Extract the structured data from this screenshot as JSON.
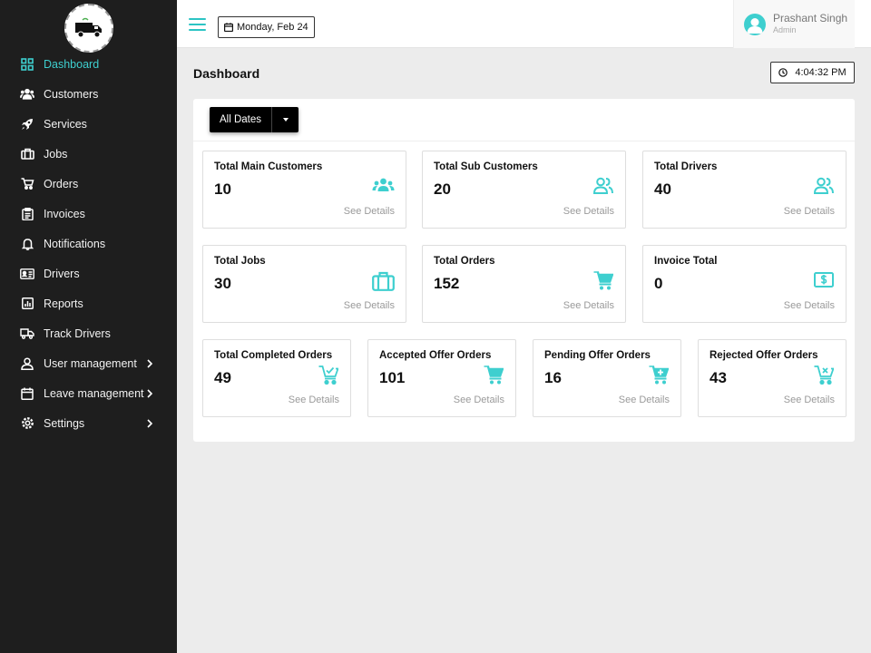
{
  "sidebar": {
    "items": [
      {
        "label": "Dashboard",
        "icon": "dashboard-grid-icon",
        "active": true
      },
      {
        "label": "Customers",
        "icon": "users-icon"
      },
      {
        "label": "Services",
        "icon": "rocket-icon"
      },
      {
        "label": "Jobs",
        "icon": "briefcase-icon"
      },
      {
        "label": "Orders",
        "icon": "cart-icon"
      },
      {
        "label": "Invoices",
        "icon": "clipboard-icon"
      },
      {
        "label": "Notifications",
        "icon": "bell-icon"
      },
      {
        "label": "Drivers",
        "icon": "id-card-icon"
      },
      {
        "label": "Reports",
        "icon": "chart-icon"
      },
      {
        "label": "Track Drivers",
        "icon": "truck-icon"
      },
      {
        "label": "User management",
        "icon": "user-icon"
      },
      {
        "label": "Leave management",
        "icon": "calendar-icon"
      },
      {
        "label": "Settings",
        "icon": "gear-icon"
      }
    ]
  },
  "header": {
    "date": "Monday, Feb 24",
    "user_name": "Prashant Singh",
    "user_role": "Admin"
  },
  "main": {
    "title": "Dashboard",
    "time": "4:04:32 PM",
    "filter_label": "All Dates"
  },
  "cards": [
    {
      "title": "Total Main Customers",
      "value": "10",
      "link": "See Details",
      "icon": "users-group-icon"
    },
    {
      "title": "Total Sub Customers",
      "value": "20",
      "link": "See Details",
      "icon": "user-friends-icon"
    },
    {
      "title": "Total Drivers",
      "value": "40",
      "link": "See Details",
      "icon": "user-friends-icon"
    },
    {
      "title": "Total Jobs",
      "value": "30",
      "link": "See Details",
      "icon": "briefcase-icon"
    },
    {
      "title": "Total Orders",
      "value": "152",
      "link": "See Details",
      "icon": "cart-icon"
    },
    {
      "title": "Invoice Total",
      "value": "0",
      "link": "See Details",
      "icon": "money-bill-icon"
    },
    {
      "title": "Total Completed Orders",
      "value": "49",
      "link": "See Details",
      "icon": "cart-check-icon"
    },
    {
      "title": "Accepted Offer Orders",
      "value": "101",
      "link": "See Details",
      "icon": "cart-icon"
    },
    {
      "title": "Pending Offer Orders",
      "value": "16",
      "link": "See Details",
      "icon": "cart-plus-icon"
    },
    {
      "title": "Rejected Offer Orders",
      "value": "43",
      "link": "See Details",
      "icon": "cart-x-icon"
    }
  ],
  "colors": {
    "accent": "#3ecfcf",
    "sidebar_bg": "#1e1e1e",
    "page_bg": "#ececec"
  }
}
